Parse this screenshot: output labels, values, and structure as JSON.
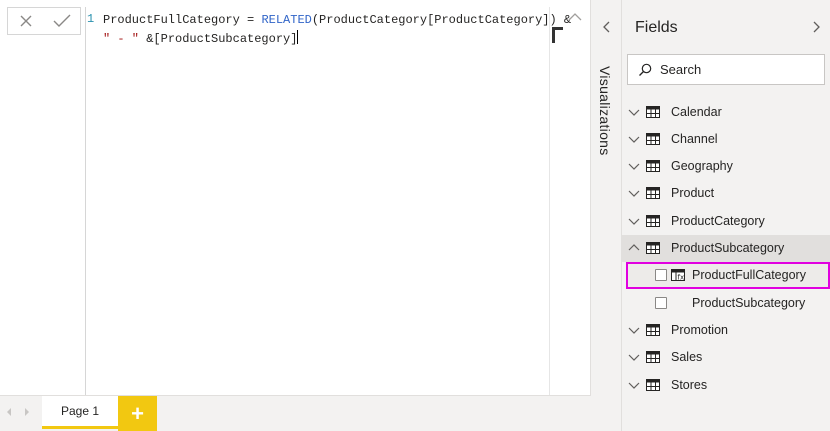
{
  "formula": {
    "line_number": "1",
    "line1_pre": "ProductFullCategory = ",
    "line1_fn": "RELATED",
    "line1_post": "(ProductCategory[ProductCategory]) &",
    "line2_str": "\" - \"",
    "line2_post": " &[ProductSubcategory]"
  },
  "pages": {
    "tab_label": "Page 1",
    "add_label": "+"
  },
  "visualizations": {
    "label": "Visualizations"
  },
  "fields": {
    "title": "Fields",
    "search_placeholder": "Search",
    "tables": [
      {
        "label": "Calendar",
        "expanded": false
      },
      {
        "label": "Channel",
        "expanded": false
      },
      {
        "label": "Geography",
        "expanded": false
      },
      {
        "label": "Product",
        "expanded": false
      },
      {
        "label": "ProductCategory",
        "expanded": false
      },
      {
        "label": "ProductSubcategory",
        "expanded": true
      },
      {
        "label": "Promotion",
        "expanded": false
      },
      {
        "label": "Sales",
        "expanded": false
      },
      {
        "label": "Stores",
        "expanded": false
      }
    ],
    "subcategory_fields": [
      {
        "label": "ProductFullCategory",
        "calculated": true,
        "selected": false
      },
      {
        "label": "ProductSubcategory",
        "calculated": false,
        "selected": false
      }
    ]
  },
  "colors": {
    "accent_yellow": "#f2c811",
    "highlight_magenta": "#e100e0",
    "function_blue": "#3165c8",
    "string_red": "#a31515"
  }
}
